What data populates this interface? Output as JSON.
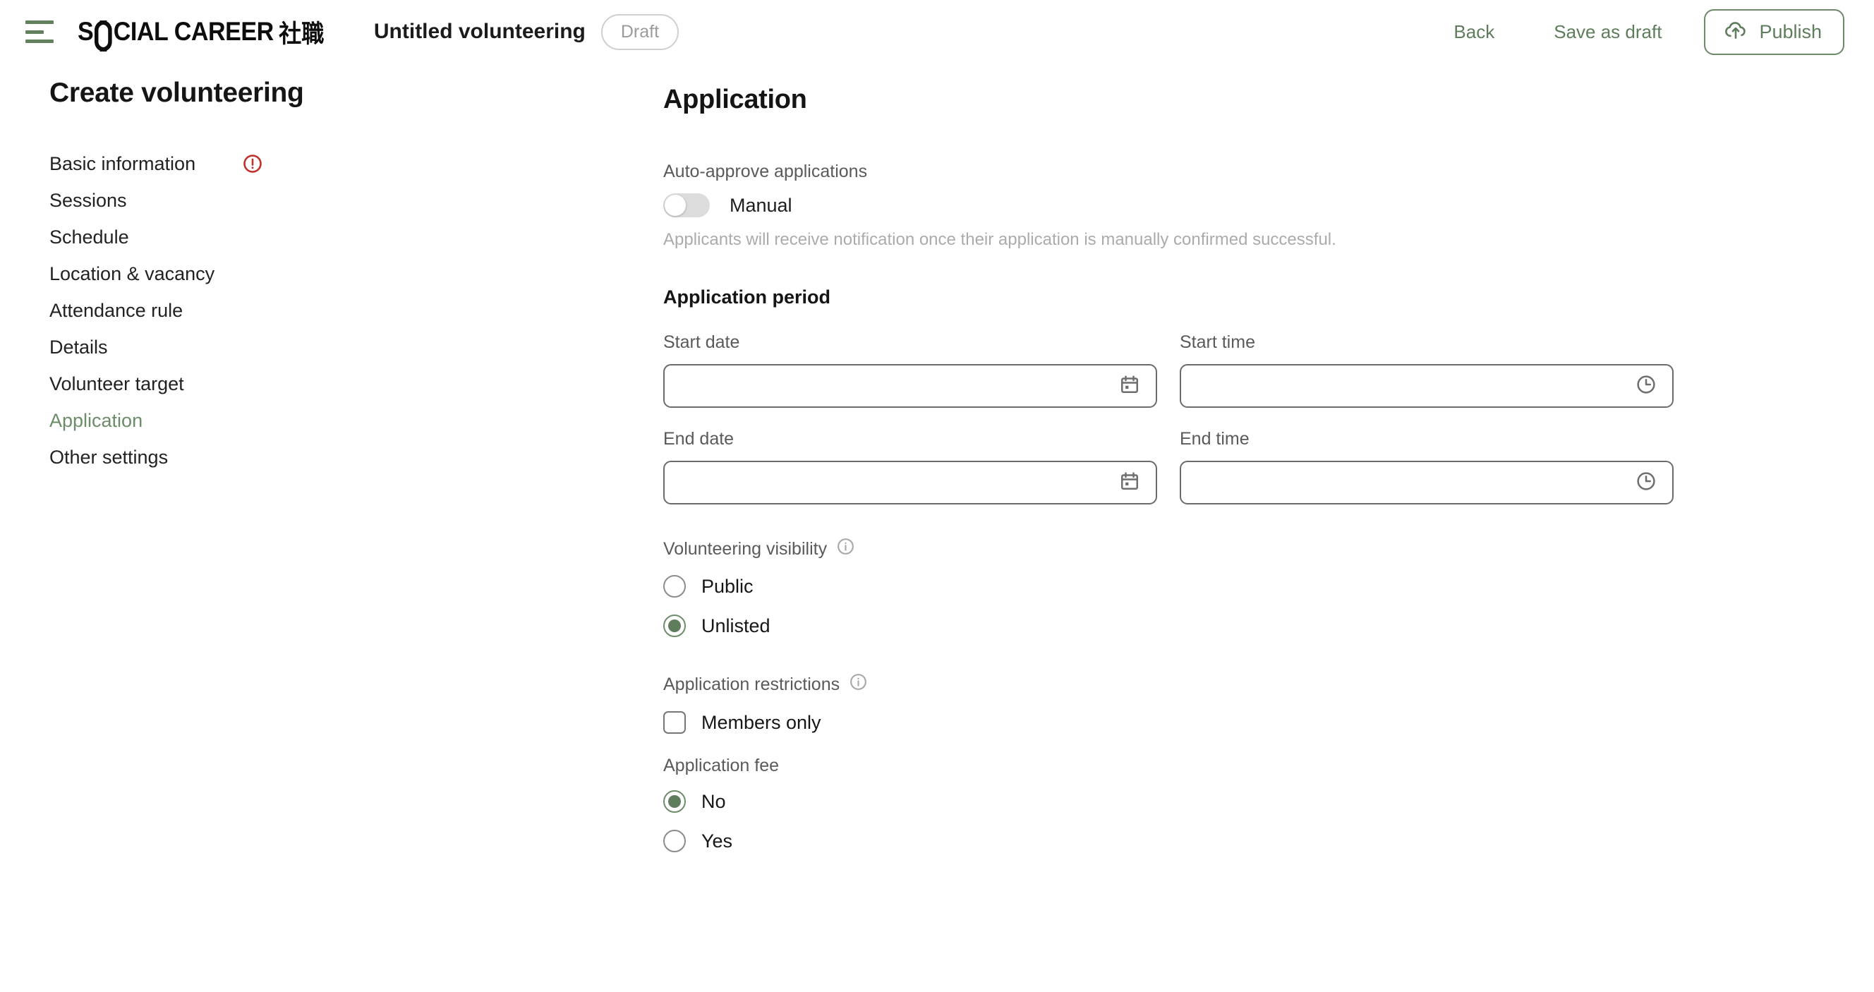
{
  "header": {
    "menu_icon": "hamburger-menu-icon",
    "logo": {
      "part1": "S",
      "part2": "CIAL CAREER",
      "cjk": "社職"
    },
    "document_title": "Untitled volunteering",
    "status_badge": "Draft",
    "back_label": "Back",
    "save_draft_label": "Save as draft",
    "publish_label": "Publish",
    "publish_icon": "cloud-upload-icon"
  },
  "sidebar": {
    "title": "Create volunteering",
    "items": [
      {
        "label": "Basic information",
        "active": false,
        "error": true
      },
      {
        "label": "Sessions",
        "active": false,
        "error": false
      },
      {
        "label": "Schedule",
        "active": false,
        "error": false
      },
      {
        "label": "Location & vacancy",
        "active": false,
        "error": false
      },
      {
        "label": "Attendance rule",
        "active": false,
        "error": false
      },
      {
        "label": "Details",
        "active": false,
        "error": false
      },
      {
        "label": "Volunteer target",
        "active": false,
        "error": false
      },
      {
        "label": "Application",
        "active": true,
        "error": false
      },
      {
        "label": "Other settings",
        "active": false,
        "error": false
      }
    ]
  },
  "main": {
    "section_title": "Application",
    "auto_approve": {
      "label": "Auto-approve applications",
      "toggle_state": "off",
      "toggle_text": "Manual",
      "helper": "Applicants will receive notification once their application is manually confirmed successful."
    },
    "application_period": {
      "title": "Application period",
      "start_date": {
        "label": "Start date",
        "value": "",
        "icon": "calendar-icon"
      },
      "start_time": {
        "label": "Start time",
        "value": "",
        "icon": "clock-icon"
      },
      "end_date": {
        "label": "End date",
        "value": "",
        "icon": "calendar-icon"
      },
      "end_time": {
        "label": "End time",
        "value": "",
        "icon": "clock-icon"
      }
    },
    "visibility": {
      "label": "Volunteering visibility",
      "info_icon": "info-icon",
      "options": [
        {
          "label": "Public",
          "selected": false
        },
        {
          "label": "Unlisted",
          "selected": true
        }
      ]
    },
    "restrictions": {
      "label": "Application restrictions",
      "info_icon": "info-icon",
      "checkbox_label": "Members only",
      "checked": false
    },
    "application_fee": {
      "label": "Application fee",
      "options": [
        {
          "label": "No",
          "selected": true
        },
        {
          "label": "Yes",
          "selected": false
        }
      ]
    }
  },
  "colors": {
    "accent_green": "#5f7d5c",
    "error_red": "#c0322b",
    "muted_grey": "#9b9b9b",
    "border_grey": "#6b6b6b"
  }
}
